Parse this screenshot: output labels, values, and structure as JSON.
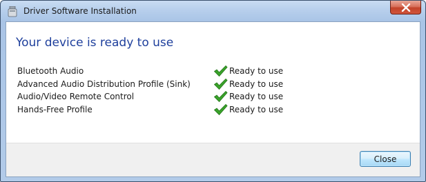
{
  "window": {
    "title": "Driver Software Installation"
  },
  "heading": "Your device is ready to use",
  "devices": [
    {
      "name": "Bluetooth Audio",
      "status": "Ready to use",
      "status_icon": "checkmark-icon"
    },
    {
      "name": "Advanced Audio Distribution Profile (Sink)",
      "status": "Ready to use",
      "status_icon": "checkmark-icon"
    },
    {
      "name": "Audio/Video Remote Control",
      "status": "Ready to use",
      "status_icon": "checkmark-icon"
    },
    {
      "name": "Hands-Free Profile",
      "status": "Ready to use",
      "status_icon": "checkmark-icon"
    }
  ],
  "buttons": {
    "close_label": "Close"
  },
  "colors": {
    "heading": "#1e3f9c",
    "check": "#3aa32a",
    "titlebar_close": "#c2432a"
  }
}
